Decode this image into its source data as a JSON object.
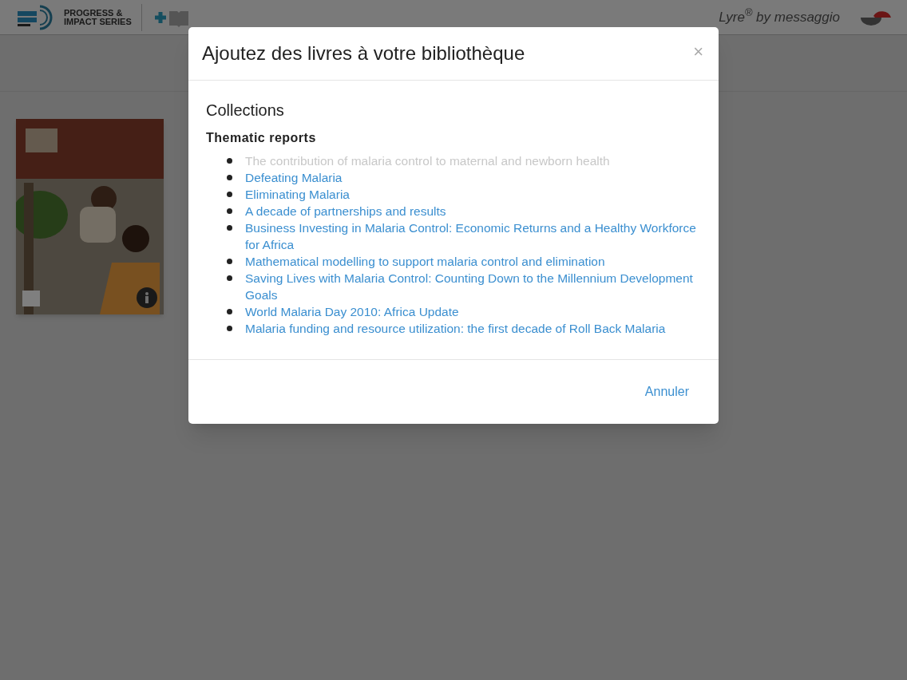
{
  "header": {
    "series_title": "PROGRESS &\nIMPACT SERIES",
    "brand": "Lyre$^{®}$ by messaggio"
  },
  "dialog": {
    "title": "Ajoutez des livres à votre bibliothèque",
    "close": "×",
    "section": "Collections",
    "groups": [
      {
        "heading": "Thematic reports",
        "items": [
          {
            "label": "The contribution of malaria control to maternal and newborn health",
            "disabled": true
          },
          {
            "label": "Defeating Malaria",
            "disabled": false
          },
          {
            "label": "Eliminating Malaria",
            "disabled": false
          },
          {
            "label": "A decade of partnerships and results",
            "disabled": false
          },
          {
            "label": "Business Investing in Malaria Control: Economic Returns and a Healthy Workforce for Africa",
            "disabled": false
          },
          {
            "label": "Mathematical modelling to support malaria control and elimination",
            "disabled": false
          },
          {
            "label": "Saving Lives with Malaria Control: Counting Down to the Millennium Development Goals",
            "disabled": false
          },
          {
            "label": "World Malaria Day 2010: Africa Update",
            "disabled": false
          },
          {
            "label": "Malaria funding and resource utilization: the first decade of Roll Back Malaria",
            "disabled": false
          }
        ]
      }
    ],
    "cancel": "Annuler"
  }
}
